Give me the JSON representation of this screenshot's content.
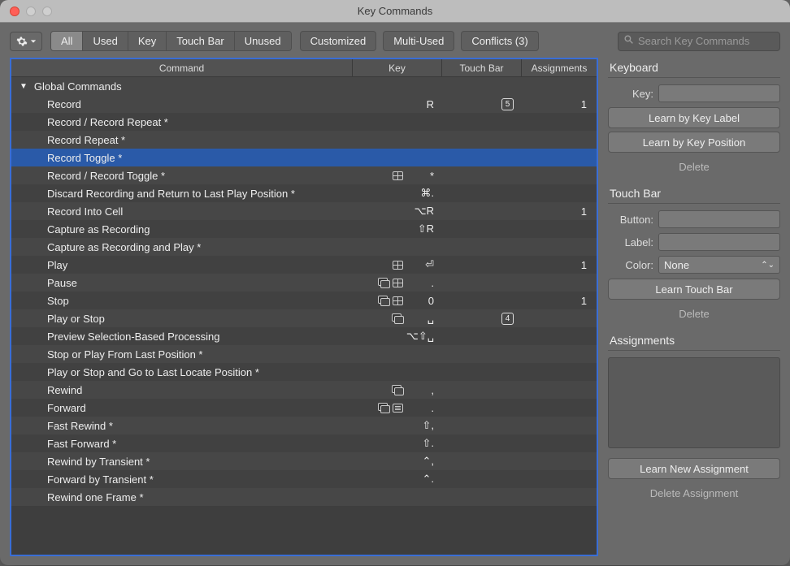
{
  "window": {
    "title": "Key Commands"
  },
  "toolbar": {
    "filters": [
      "All",
      "Used",
      "Key",
      "Touch Bar",
      "Unused"
    ],
    "active_filter": 0,
    "chips": [
      "Customized",
      "Multi-Used",
      "Conflicts (3)"
    ]
  },
  "search": {
    "placeholder": "Search Key Commands"
  },
  "table": {
    "headers": {
      "command": "Command",
      "key": "Key",
      "touch_bar": "Touch Bar",
      "assignments": "Assignments"
    },
    "group": "Global Commands",
    "selected_index": 3,
    "rows": [
      {
        "command": "Record",
        "key": "R",
        "touch_bar": "5",
        "assignments": "1",
        "contexts": []
      },
      {
        "command": "Record / Record Repeat *",
        "key": "",
        "touch_bar": "",
        "assignments": "",
        "contexts": []
      },
      {
        "command": "Record Repeat *",
        "key": "",
        "touch_bar": "",
        "assignments": "",
        "contexts": []
      },
      {
        "command": "Record Toggle *",
        "key": "",
        "touch_bar": "",
        "assignments": "",
        "contexts": []
      },
      {
        "command": "Record / Record Toggle *",
        "key": "*",
        "touch_bar": "",
        "assignments": "",
        "contexts": [
          "grid"
        ]
      },
      {
        "command": "Discard Recording and Return to Last Play Position *",
        "key": "⌘.",
        "touch_bar": "",
        "assignments": "",
        "contexts": []
      },
      {
        "command": "Record Into Cell",
        "key": "⌥R",
        "touch_bar": "",
        "assignments": "1",
        "contexts": []
      },
      {
        "command": "Capture as Recording",
        "key": "⇧R",
        "touch_bar": "",
        "assignments": "",
        "contexts": []
      },
      {
        "command": "Capture as Recording and Play *",
        "key": "",
        "touch_bar": "",
        "assignments": "",
        "contexts": []
      },
      {
        "command": "Play",
        "key": "⏎",
        "touch_bar": "",
        "assignments": "1",
        "contexts": [
          "grid"
        ]
      },
      {
        "command": "Pause",
        "key": ".",
        "touch_bar": "",
        "assignments": "",
        "contexts": [
          "stack",
          "grid"
        ]
      },
      {
        "command": "Stop",
        "key": "0",
        "touch_bar": "",
        "assignments": "1",
        "contexts": [
          "stack",
          "grid"
        ]
      },
      {
        "command": "Play or Stop",
        "key": "␣",
        "touch_bar": "4",
        "assignments": "",
        "contexts": [
          "stack"
        ]
      },
      {
        "command": "Preview Selection-Based Processing",
        "key": "⌥⇧␣",
        "touch_bar": "",
        "assignments": "",
        "contexts": []
      },
      {
        "command": "Stop or Play From Last Position *",
        "key": "",
        "touch_bar": "",
        "assignments": "",
        "contexts": []
      },
      {
        "command": "Play or Stop and Go to Last Locate Position *",
        "key": "",
        "touch_bar": "",
        "assignments": "",
        "contexts": []
      },
      {
        "command": "Rewind",
        "key": ",",
        "touch_bar": "",
        "assignments": "",
        "contexts": [
          "stack"
        ]
      },
      {
        "command": "Forward",
        "key": ".",
        "touch_bar": "",
        "assignments": "",
        "contexts": [
          "stack",
          "keys"
        ]
      },
      {
        "command": "Fast Rewind *",
        "key": "⇧,",
        "touch_bar": "",
        "assignments": "",
        "contexts": []
      },
      {
        "command": "Fast Forward *",
        "key": "⇧.",
        "touch_bar": "",
        "assignments": "",
        "contexts": []
      },
      {
        "command": "Rewind by Transient *",
        "key": "⌃,",
        "touch_bar": "",
        "assignments": "",
        "contexts": []
      },
      {
        "command": "Forward by Transient *",
        "key": "⌃.",
        "touch_bar": "",
        "assignments": "",
        "contexts": []
      },
      {
        "command": "Rewind one Frame *",
        "key": "",
        "touch_bar": "",
        "assignments": "",
        "contexts": []
      }
    ]
  },
  "side": {
    "keyboard": {
      "title": "Keyboard",
      "key_label": "Key:",
      "learn_label": "Learn by Key Label",
      "learn_position": "Learn by Key Position",
      "delete": "Delete"
    },
    "touchbar": {
      "title": "Touch Bar",
      "button_label": "Button:",
      "label_label": "Label:",
      "color_label": "Color:",
      "color_value": "None",
      "learn": "Learn Touch Bar",
      "delete": "Delete"
    },
    "assignments": {
      "title": "Assignments",
      "learn": "Learn New Assignment",
      "delete": "Delete Assignment"
    }
  }
}
